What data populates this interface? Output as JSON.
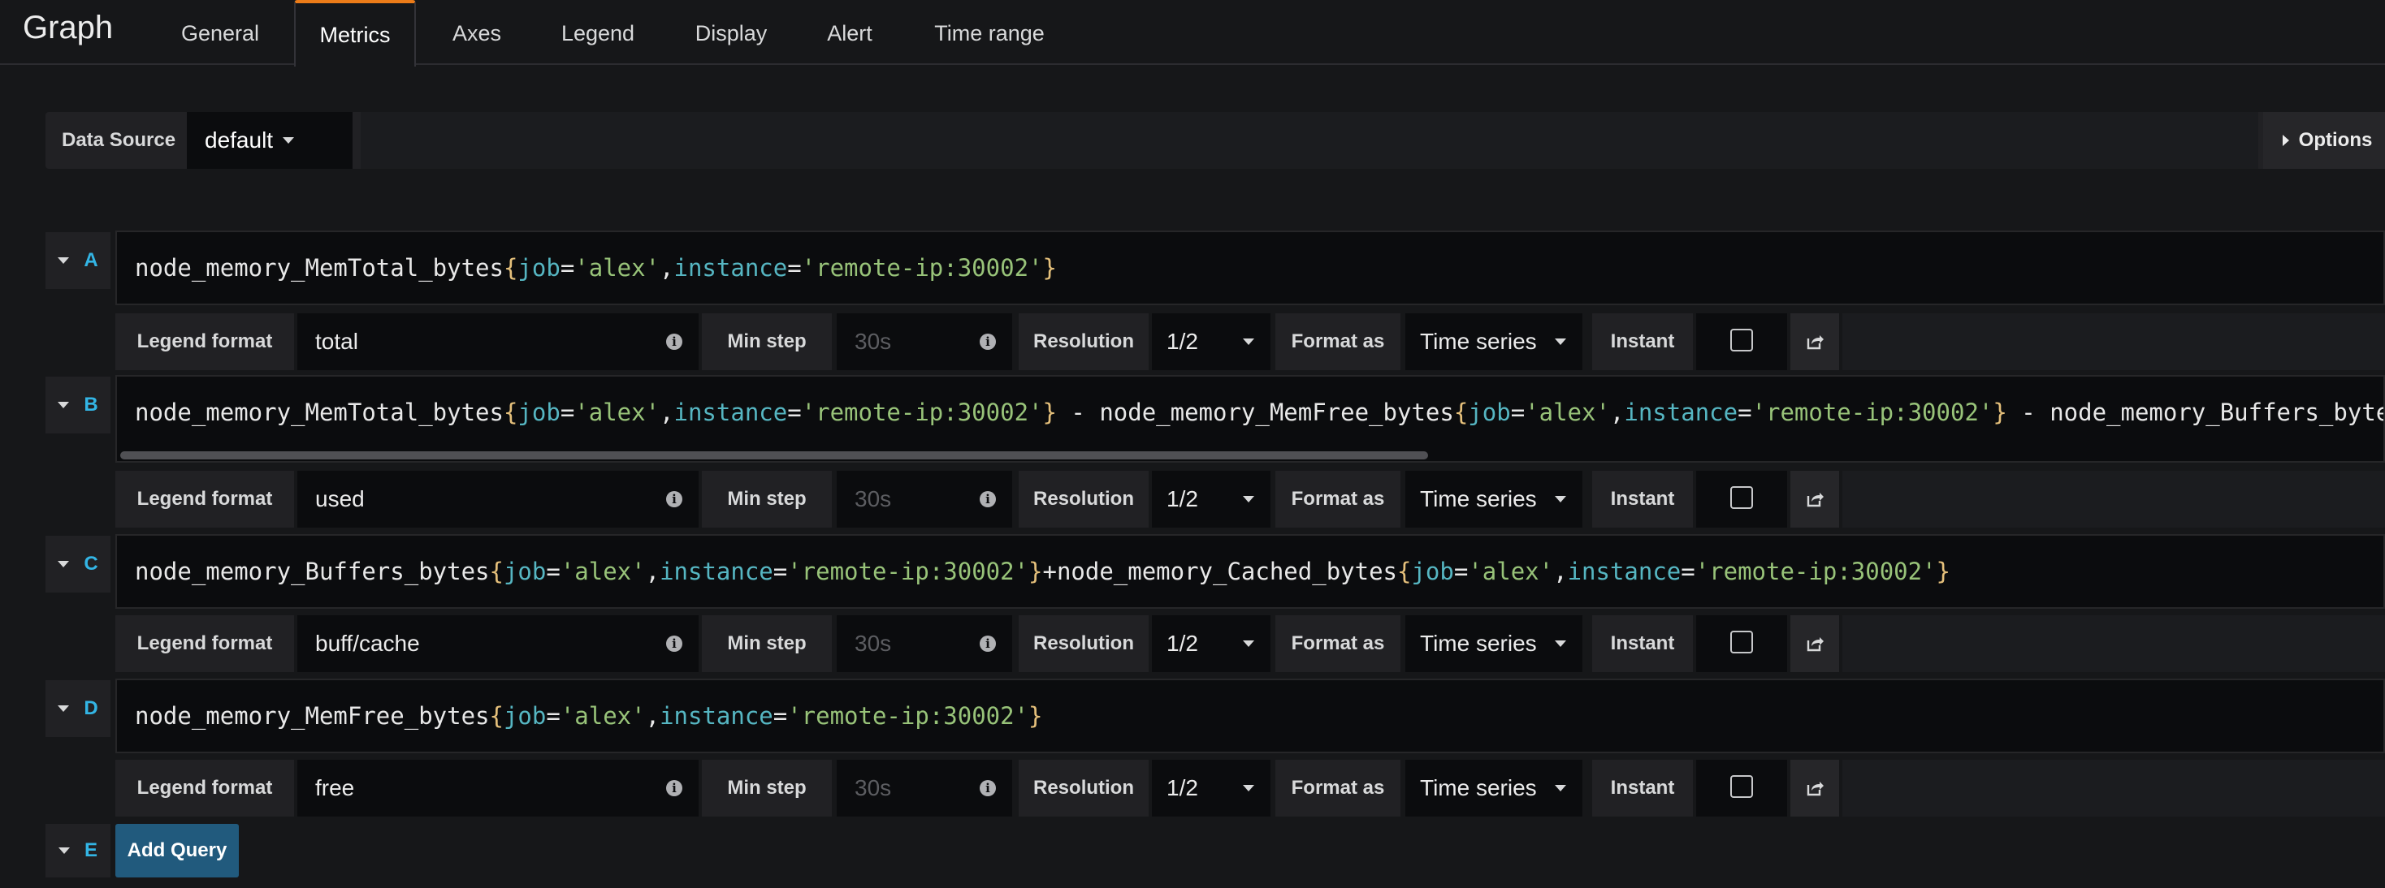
{
  "header": {
    "title": "Graph",
    "tabs": [
      "General",
      "Metrics",
      "Axes",
      "Legend",
      "Display",
      "Alert",
      "Time range"
    ],
    "active_tab": "Metrics"
  },
  "datasource": {
    "label": "Data Source",
    "value": "default",
    "options_label": "Options"
  },
  "queries": [
    {
      "letter": "A",
      "expr": "node_memory_MemTotal_bytes{job='alex',instance='remote-ip:30002'}",
      "legend_format_label": "Legend format",
      "legend_format": "total",
      "min_step_label": "Min step",
      "min_step_placeholder": "30s",
      "resolution_label": "Resolution",
      "resolution": "1/2",
      "format_as_label": "Format as",
      "format_as": "Time series",
      "instant_label": "Instant"
    },
    {
      "letter": "B",
      "expr": "node_memory_MemTotal_bytes{job='alex',instance='remote-ip:30002'} - node_memory_MemFree_bytes{job='alex',instance='remote-ip:30002'} - node_memory_Buffers_bytes{job=",
      "legend_format_label": "Legend format",
      "legend_format": "used",
      "min_step_label": "Min step",
      "min_step_placeholder": "30s",
      "resolution_label": "Resolution",
      "resolution": "1/2",
      "format_as_label": "Format as",
      "format_as": "Time series",
      "instant_label": "Instant"
    },
    {
      "letter": "C",
      "expr": "node_memory_Buffers_bytes{job='alex',instance='remote-ip:30002'}+node_memory_Cached_bytes{job='alex',instance='remote-ip:30002'}",
      "legend_format_label": "Legend format",
      "legend_format": "buff/cache",
      "min_step_label": "Min step",
      "min_step_placeholder": "30s",
      "resolution_label": "Resolution",
      "resolution": "1/2",
      "format_as_label": "Format as",
      "format_as": "Time series",
      "instant_label": "Instant"
    },
    {
      "letter": "D",
      "expr": "node_memory_MemFree_bytes{job='alex',instance='remote-ip:30002'}",
      "legend_format_label": "Legend format",
      "legend_format": "free",
      "min_step_label": "Min step",
      "min_step_placeholder": "30s",
      "resolution_label": "Resolution",
      "resolution": "1/2",
      "format_as_label": "Format as",
      "format_as": "Time series",
      "instant_label": "Instant"
    }
  ],
  "add_query": {
    "letter": "E",
    "label": "Add Query"
  },
  "colors": {
    "background": "#161719",
    "accent_tab": "#eb7b18",
    "query_letter": "#33b5e5",
    "add_query_button": "#215a7d",
    "promql_brace": "#e5c07b",
    "promql_label_key": "#56b6c2",
    "promql_string": "#98c379"
  },
  "icons": {
    "info": "info-icon",
    "share": "share-icon",
    "caret": "chevron-down-icon",
    "options_caret": "caret-right-icon"
  }
}
